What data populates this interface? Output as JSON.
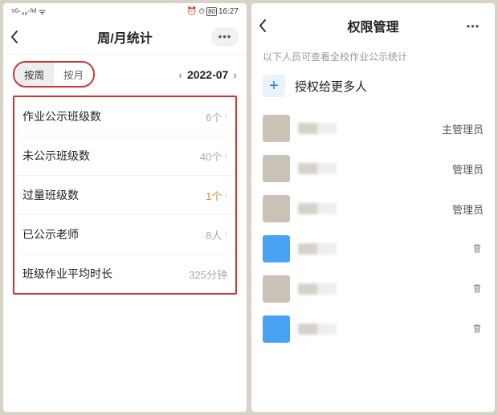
{
  "left": {
    "statusbar": {
      "signal": "5G ⁴⁶ ᴴᴰ",
      "wifi": "",
      "icons": "⏰ ⏲ 📶",
      "battery": "80",
      "time": "16:27"
    },
    "header": {
      "title": "周/月统计"
    },
    "segment": {
      "optA": "按周",
      "optB": "按月"
    },
    "date": {
      "value": "2022-07"
    },
    "stats": [
      {
        "label": "作业公示班级数",
        "value": "6个",
        "orange": false,
        "arrow": true
      },
      {
        "label": "未公示班级数",
        "value": "40个",
        "orange": false,
        "arrow": true
      },
      {
        "label": "过量班级数",
        "value": "1个",
        "orange": true,
        "arrow": true
      },
      {
        "label": "已公示老师",
        "value": "8人",
        "orange": false,
        "arrow": true
      },
      {
        "label": "班级作业平均时长",
        "value": "325分钟",
        "orange": false,
        "arrow": false
      }
    ]
  },
  "right": {
    "header": {
      "title": "权限管理"
    },
    "subtitle": "以下人员可查看全校作业公示统计",
    "addLabel": "授权给更多人",
    "users": [
      {
        "role": "主管理员",
        "blue": false,
        "trash": false
      },
      {
        "role": "管理员",
        "blue": false,
        "trash": false
      },
      {
        "role": "管理员",
        "blue": false,
        "trash": false
      },
      {
        "role": "",
        "blue": true,
        "trash": true
      },
      {
        "role": "",
        "blue": false,
        "trash": true
      },
      {
        "role": "",
        "blue": true,
        "trash": true
      }
    ]
  }
}
